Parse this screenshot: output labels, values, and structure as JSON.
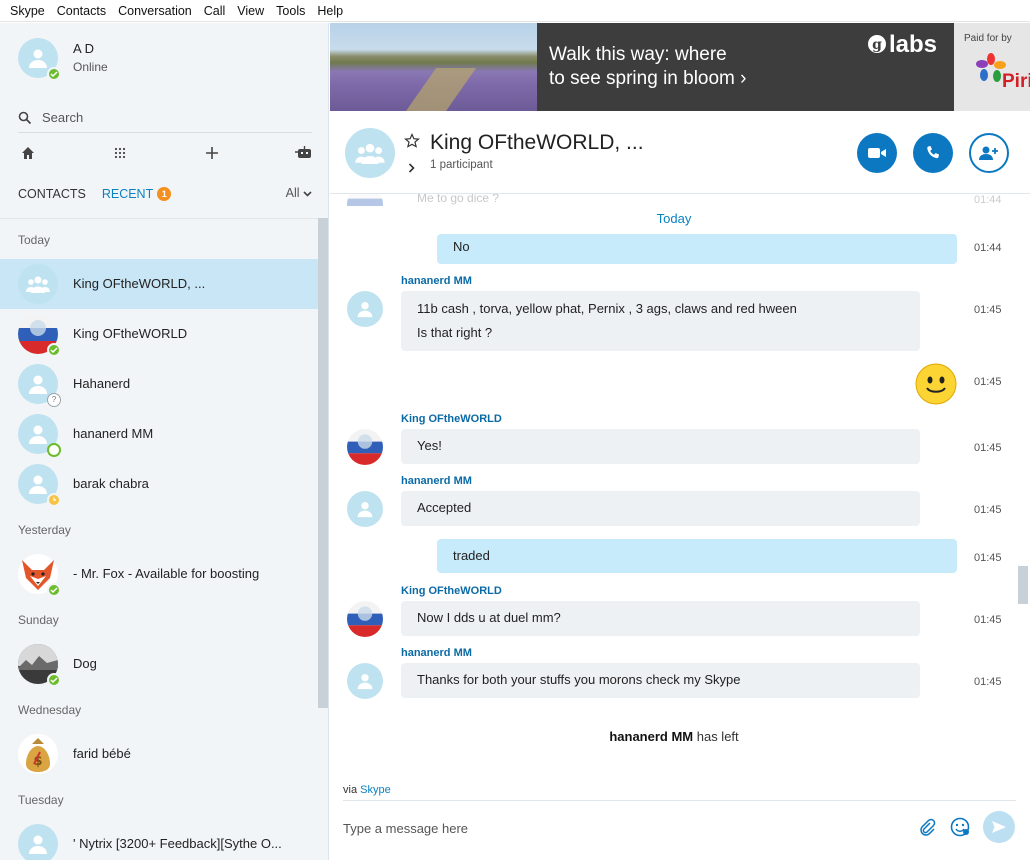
{
  "menu": [
    "Skype",
    "Contacts",
    "Conversation",
    "Call",
    "View",
    "Tools",
    "Help"
  ],
  "profile": {
    "name": "A D",
    "status": "Online"
  },
  "search": {
    "label": "Search"
  },
  "tabs": {
    "contacts": "CONTACTS",
    "recent": "RECENT",
    "recent_badge": "1",
    "filter": "All"
  },
  "sections": {
    "today": "Today",
    "yesterday": "Yesterday",
    "sunday": "Sunday",
    "wednesday": "Wednesday",
    "tuesday": "Tuesday"
  },
  "contacts": [
    {
      "name": "King OFtheWORLD, ...",
      "presence": "group"
    },
    {
      "name": "King OFtheWORLD",
      "presence": "online"
    },
    {
      "name": "Hahanerd",
      "presence": "unknown"
    },
    {
      "name": "hananerd MM",
      "presence": "offline"
    },
    {
      "name": "barak chabra",
      "presence": "away"
    },
    {
      "name": "- Mr. Fox - Available for boosting",
      "presence": "online"
    },
    {
      "name": "Dog",
      "presence": "online"
    },
    {
      "name": "farid bébé",
      "presence": "none"
    },
    {
      "name": "'     Nytrix [3200+ Feedback][Sythe O...",
      "presence": "none"
    }
  ],
  "ad": {
    "headline_1": "Walk this way: where",
    "headline_2": "to see spring in bloom ›",
    "brand": "labs",
    "paid_for_by": "Paid for by",
    "sponsor": "Piri"
  },
  "conversation": {
    "title": "King OFtheWORLD, ...",
    "participants": "1 participant"
  },
  "chat": {
    "partial_top": "Me to go dice ?",
    "partial_time": "01:44",
    "day": "Today",
    "messages": [
      {
        "dir": "out",
        "text": "No",
        "time": "01:44"
      },
      {
        "sender": "hananerd MM",
        "dir": "in",
        "lines": [
          "11b cash , torva, yellow phat, Pernix , 3 ags, claws and red hween",
          "Is that right ?"
        ],
        "time": "01:45"
      },
      {
        "dir": "out",
        "emoticon": "smile",
        "time": "01:45"
      },
      {
        "sender": "King OFtheWORLD",
        "dir": "in",
        "lines": [
          "Yes!"
        ],
        "time": "01:45"
      },
      {
        "sender": "hananerd MM",
        "dir": "in",
        "lines": [
          "Accepted"
        ],
        "time": "01:45"
      },
      {
        "dir": "out",
        "text": "traded",
        "time": "01:45"
      },
      {
        "sender": "King OFtheWORLD",
        "dir": "in",
        "lines": [
          "Now I dds u at duel mm?"
        ],
        "time": "01:45"
      },
      {
        "sender": "hananerd MM",
        "dir": "in",
        "lines": [
          "Thanks for both your stuffs you morons check my Skype"
        ],
        "time": "01:45"
      }
    ],
    "system_name": "hananerd MM",
    "system_text": " has left"
  },
  "compose": {
    "via": "via ",
    "via_link": "Skype",
    "placeholder": "Type a message here"
  },
  "colors": {
    "accent": "#0b78c1",
    "selected_row": "#c8e6f6",
    "outgoing_bubble": "#c7ebfb",
    "incoming_bubble": "#eef1f4",
    "online": "#6cbc2c",
    "away": "#f6c343",
    "badge": "#f5901e"
  }
}
